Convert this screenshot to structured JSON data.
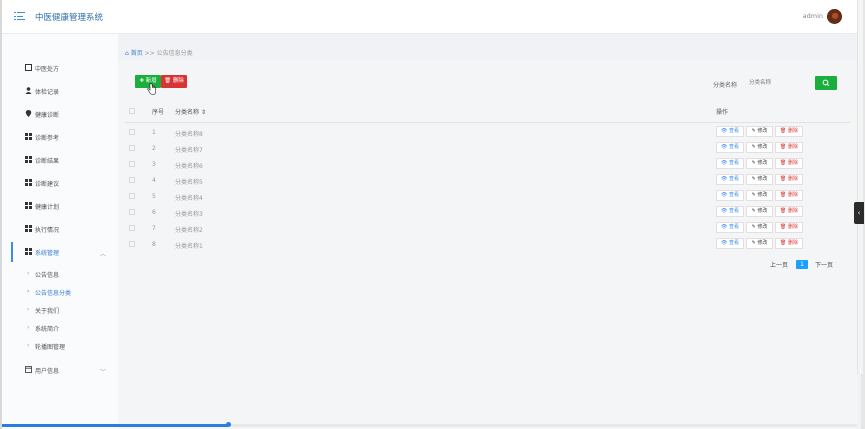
{
  "header": {
    "app_title": "中医健康管理系统",
    "user_name": "admin"
  },
  "sidebar": {
    "items": [
      {
        "label": "中医处方",
        "icon": "checklist-icon"
      },
      {
        "label": "体检记录",
        "icon": "user-icon"
      },
      {
        "label": "健康诊断",
        "icon": "location-pin-icon"
      },
      {
        "label": "诊断参考",
        "icon": "grid-icon"
      },
      {
        "label": "诊断结果",
        "icon": "grid-icon"
      },
      {
        "label": "诊断建议",
        "icon": "grid-icon"
      },
      {
        "label": "健康计划",
        "icon": "grid-icon"
      },
      {
        "label": "执行情况",
        "icon": "grid-icon"
      },
      {
        "label": "系统管理",
        "icon": "grid-icon"
      },
      {
        "label": "用户信息",
        "icon": "window-icon"
      }
    ],
    "subitems": [
      {
        "label": "公告信息"
      },
      {
        "label": "公告信息分类"
      },
      {
        "label": "关于我们"
      },
      {
        "label": "系统简介"
      },
      {
        "label": "轮播图管理"
      }
    ]
  },
  "breadcrumb": {
    "home": "首页",
    "separator": ">>",
    "current": "公告信息分类"
  },
  "toolbar": {
    "add_label": "新增",
    "delete_label": "删除"
  },
  "search": {
    "label": "分类名称",
    "placeholder": "分类名称"
  },
  "table": {
    "columns": {
      "index": "序号",
      "name": "分类名称",
      "actions": "操作"
    },
    "rows": [
      {
        "index": "1",
        "name": "分类名称8"
      },
      {
        "index": "2",
        "name": "分类名称7"
      },
      {
        "index": "3",
        "name": "分类名称6"
      },
      {
        "index": "4",
        "name": "分类名称5"
      },
      {
        "index": "5",
        "name": "分类名称4"
      },
      {
        "index": "6",
        "name": "分类名称3"
      },
      {
        "index": "7",
        "name": "分类名称2"
      },
      {
        "index": "8",
        "name": "分类名称1"
      }
    ],
    "action_labels": {
      "view": "查看",
      "edit": "修改",
      "delete": "删除"
    }
  },
  "pagination": {
    "prev": "上一页",
    "current": "1",
    "next": "下一页"
  },
  "colors": {
    "primary_blue": "#3a8ee6",
    "success_green": "#1aae3d",
    "danger_red": "#d93434",
    "page_active": "#1e9fff"
  }
}
